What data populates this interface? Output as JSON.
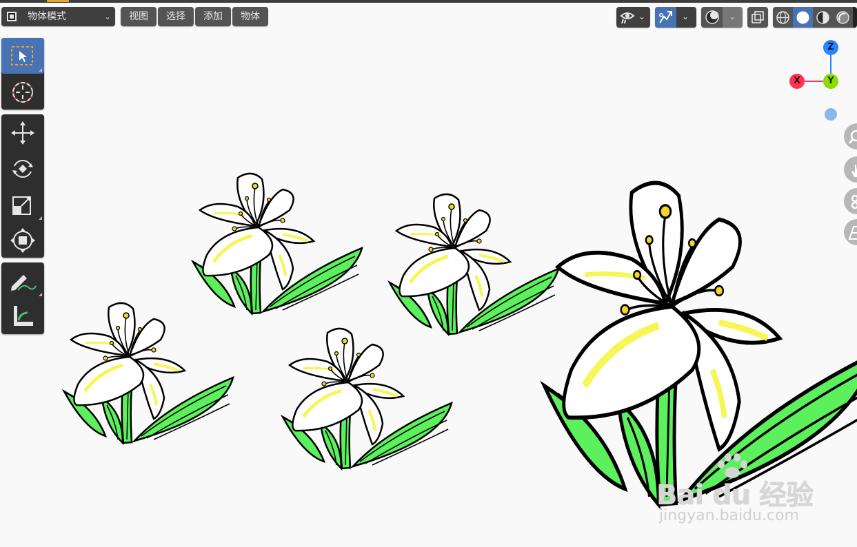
{
  "header": {
    "mode_label": "物体模式",
    "menu": {
      "view": "视图",
      "select": "选择",
      "add": "添加",
      "object": "物体"
    },
    "icons": {
      "mode": "object-mode-icon",
      "visibility": "eye-visibility-icon",
      "gizmo": "gizmo-arrow-icon",
      "overlay": "overlay-icon",
      "xray": "xray-toggle-icon",
      "shading_wireframe": "wireframe-shading-icon",
      "shading_solid": "solid-shading-icon",
      "shading_material": "material-shading-icon",
      "shading_rendered": "rendered-shading-icon"
    },
    "active_shading": "solid"
  },
  "toolbar": {
    "tools": [
      {
        "name": "select-box",
        "icon": "select-box-icon",
        "active": true
      },
      {
        "name": "cursor",
        "icon": "cursor-icon",
        "active": false
      },
      {
        "name": "move",
        "icon": "move-icon",
        "active": false
      },
      {
        "name": "rotate",
        "icon": "rotate-icon",
        "active": false
      },
      {
        "name": "scale",
        "icon": "scale-icon",
        "active": false
      },
      {
        "name": "transform",
        "icon": "transform-icon",
        "active": false
      },
      {
        "name": "annotate",
        "icon": "annotate-pencil-icon",
        "active": false
      },
      {
        "name": "measure",
        "icon": "measure-ruler-icon",
        "active": false
      }
    ]
  },
  "nav_gizmo": {
    "z_label": "Z",
    "x_label": "X",
    "y_label": "Y",
    "colors": {
      "z": "#2a84ff",
      "x": "#ff3352",
      "y": "#8bdc00"
    }
  },
  "nav_buttons": [
    "zoom-magnifier-icon",
    "pan-hand-icon",
    "camera-icon",
    "ortho-grid-icon"
  ],
  "viewport": {
    "content": "lily-flower-drawings",
    "colors": {
      "leaf": "#5df05d",
      "highlight": "#f5f53a",
      "stamen": "#f2d52a",
      "background": "#f9f9f9"
    }
  },
  "watermark": {
    "brand": "Bai du 经验",
    "url": "jingyan.baidu.com"
  },
  "colors": {
    "accent": "#4772b3",
    "button": "#545454",
    "toolbar_bg": "#2e2e2e"
  }
}
